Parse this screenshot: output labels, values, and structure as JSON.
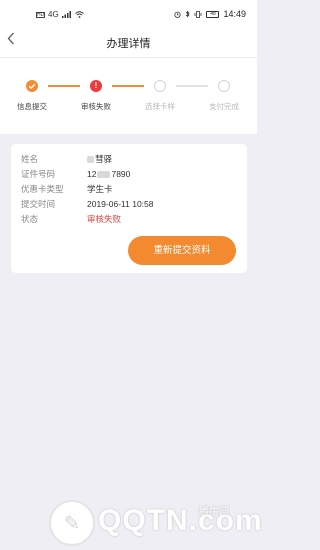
{
  "status_bar": {
    "left": "HD",
    "signal": "4G",
    "battery": "48",
    "time": "14:49"
  },
  "nav": {
    "back_icon": "chevron-left-icon",
    "title": "办理详情"
  },
  "steps": [
    {
      "label": "信息提交",
      "state": "done",
      "icon": "check-icon"
    },
    {
      "label": "审核失败",
      "state": "failed",
      "icon": "exclamation-icon"
    },
    {
      "label": "选择卡样",
      "state": "pending",
      "icon": "empty-circle-icon"
    },
    {
      "label": "支付完成",
      "state": "pending",
      "icon": "empty-circle-icon"
    }
  ],
  "details": {
    "name_label": "姓名",
    "name_value": "彗驿",
    "id_label": "证件号码",
    "id_value_prefix": "12",
    "id_value_suffix": "7890",
    "card_type_label": "优惠卡类型",
    "card_type_value": "学生卡",
    "submit_time_label": "提交时间",
    "submit_time_value": "2019-06-11 10:58",
    "status_label": "状态",
    "status_value": "审核失败"
  },
  "actions": {
    "resubmit_label": "重新提交资料"
  },
  "watermark": {
    "text": "QQTN.com",
    "cn": "腾牛网"
  },
  "colors": {
    "accent": "#f58b32",
    "fail": "#ec3b3b",
    "background": "#efeef4"
  }
}
